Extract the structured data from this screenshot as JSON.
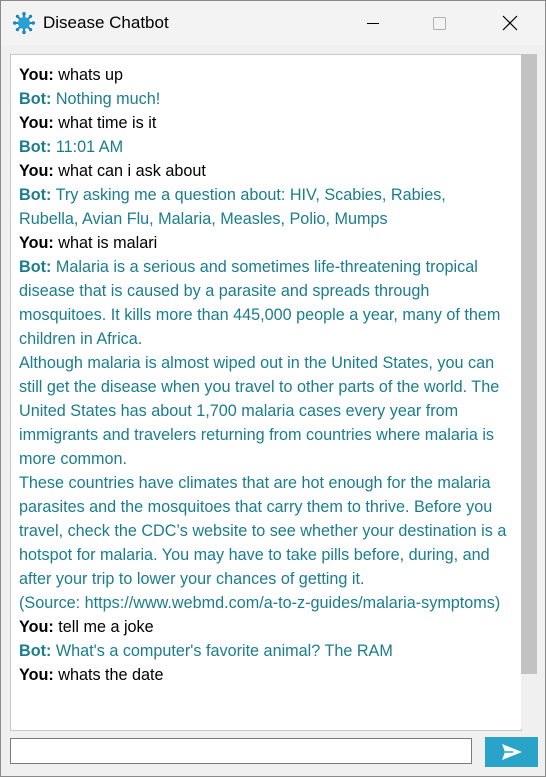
{
  "window": {
    "title": "Disease Chatbot",
    "icon": "virus-icon"
  },
  "colors": {
    "bot_text": "#1b7d8c",
    "user_text": "#000000",
    "send_button": "#2aa3c8"
  },
  "chat": {
    "messages": [
      {
        "speaker": "You:",
        "role": "user",
        "text": "whats up"
      },
      {
        "speaker": "Bot:",
        "role": "bot",
        "text": "Nothing much!"
      },
      {
        "speaker": "You:",
        "role": "user",
        "text": "what time is it"
      },
      {
        "speaker": "Bot:",
        "role": "bot",
        "text": "11:01 AM"
      },
      {
        "speaker": "You:",
        "role": "user",
        "text": "what can i ask about"
      },
      {
        "speaker": "Bot:",
        "role": "bot",
        "text": "Try asking me a question about: HIV, Scabies, Rabies, Rubella, Avian Flu, Malaria, Measles, Polio, Mumps"
      },
      {
        "speaker": "You:",
        "role": "user",
        "text": "what is malari"
      },
      {
        "speaker": "Bot:",
        "role": "bot",
        "text": "Malaria is a serious and sometimes life-threatening tropical disease that is caused by a parasite and spreads through mosquitoes. It kills more than 445,000 people a year, many of them children in Africa.",
        "paragraphs": [
          "Although malaria is almost wiped out in the United States, you can still get the disease when you travel to other parts of the world. The United States has about 1,700 malaria cases every year from immigrants and travelers returning from countries where malaria is more common.",
          "These countries have climates that are hot enough for the malaria parasites and the mosquitoes that carry them to thrive. Before you travel, check the CDC’s website to see whether your destination is a hotspot for malaria. You may have to take pills before, during, and after your trip to lower your chances of getting it.",
          "(Source: https://www.webmd.com/a-to-z-guides/malaria-symptoms)"
        ]
      },
      {
        "speaker": "You:",
        "role": "user",
        "text": "tell me a joke"
      },
      {
        "speaker": "Bot:",
        "role": "bot",
        "text": "What's a computer's favorite animal? The RAM"
      },
      {
        "speaker": "You:",
        "role": "user",
        "text": "whats the date"
      }
    ]
  },
  "input": {
    "value": "",
    "placeholder": ""
  },
  "send": {
    "icon": "send-arrow-icon"
  }
}
